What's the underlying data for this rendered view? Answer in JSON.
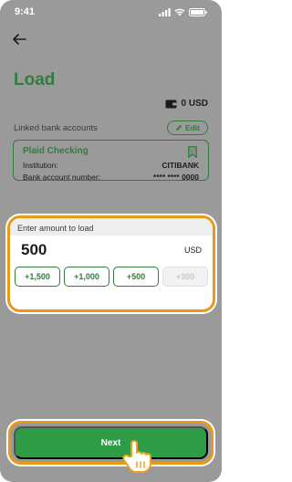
{
  "status_bar": {
    "time": "9:41"
  },
  "header": {
    "title": "Load"
  },
  "balance": {
    "amount": "0 USD"
  },
  "linked_accounts": {
    "label": "Linked bank accounts",
    "edit_label": "Edit",
    "card": {
      "name": "Plaid Checking",
      "institution_label": "Institution:",
      "institution_value": "CITIBANK",
      "account_label": "Bank account number:",
      "account_value": "**** **** 0000"
    }
  },
  "amount": {
    "label": "Enter amount to load",
    "value": "500",
    "currency": "USD",
    "quick_options": [
      "+1,500",
      "+1,000",
      "+500",
      "+300"
    ]
  },
  "actions": {
    "next_label": "Next"
  },
  "colors": {
    "accent": "#2e7d3a",
    "highlight": "#e89a17",
    "button": "#2e9b47"
  }
}
